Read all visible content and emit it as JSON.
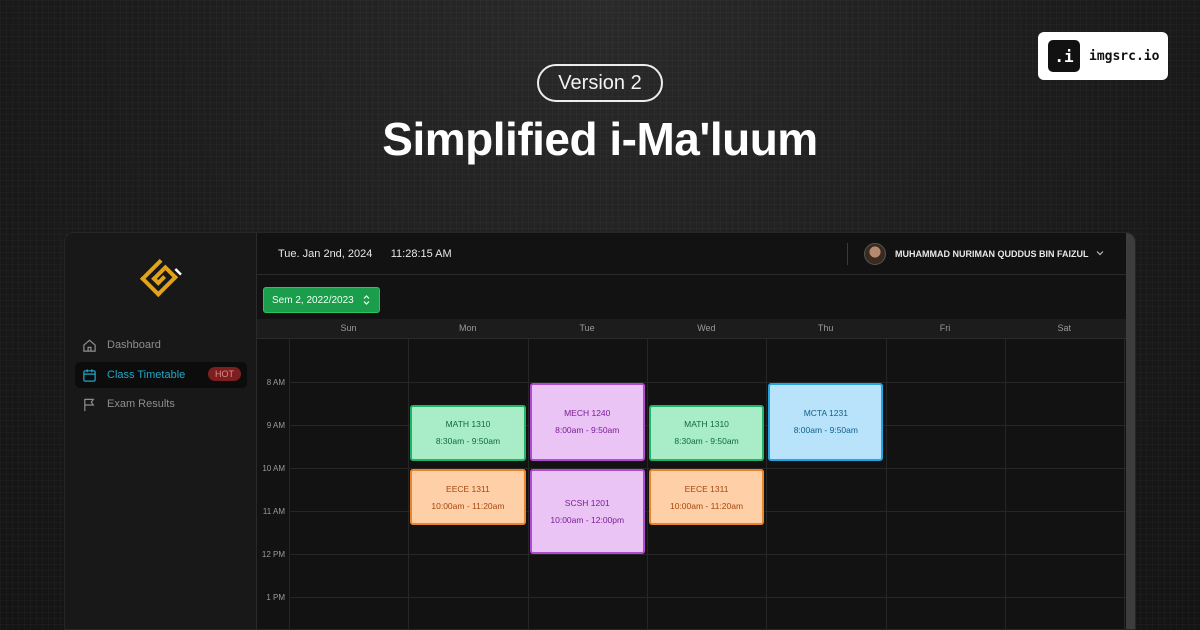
{
  "banner": {
    "version_label": "Version 2",
    "title": "Simplified i-Ma'luum",
    "imgsrc_logo": ".i",
    "imgsrc_label": "imgsrc.io"
  },
  "sidebar": {
    "logo_icon": "kufi-square-logo-icon",
    "items": [
      {
        "label": "Dashboard",
        "icon": "home-icon",
        "active": false
      },
      {
        "label": "Class Timetable",
        "icon": "calendar-icon",
        "active": true,
        "badge": "HOT"
      },
      {
        "label": "Exam Results",
        "icon": "flag-icon",
        "active": false
      }
    ]
  },
  "topbar": {
    "date": "Tue. Jan 2nd, 2024",
    "time": "11:28:15 AM",
    "user_name": "MUHAMMAD NURIMAN QUDDUS BIN FAIZUL"
  },
  "semester_select": {
    "value": "Sem 2, 2022/2023"
  },
  "calendar": {
    "days": [
      "Sun",
      "Mon",
      "Tue",
      "Wed",
      "Thu",
      "Fri",
      "Sat"
    ],
    "hours": [
      "8 AM",
      "9 AM",
      "10 AM",
      "11 AM",
      "12 PM",
      "1 PM"
    ],
    "events": [
      {
        "code": "MATH 1310",
        "time": "8:30am - 9:50am",
        "day": 1,
        "start": 8.5,
        "end": 9.83,
        "color": "green"
      },
      {
        "code": "MECH 1240",
        "time": "8:00am - 9:50am",
        "day": 2,
        "start": 8.0,
        "end": 9.83,
        "color": "purple"
      },
      {
        "code": "MATH 1310",
        "time": "8:30am - 9:50am",
        "day": 3,
        "start": 8.5,
        "end": 9.83,
        "color": "green"
      },
      {
        "code": "MCTA 1231",
        "time": "8:00am - 9:50am",
        "day": 4,
        "start": 8.0,
        "end": 9.83,
        "color": "blue"
      },
      {
        "code": "EECE 1311",
        "time": "10:00am - 11:20am",
        "day": 1,
        "start": 10.0,
        "end": 11.33,
        "color": "orange"
      },
      {
        "code": "SCSH 1201",
        "time": "10:00am - 12:00pm",
        "day": 2,
        "start": 10.0,
        "end": 12.0,
        "color": "purple"
      },
      {
        "code": "EECE 1311",
        "time": "10:00am - 11:20am",
        "day": 3,
        "start": 10.0,
        "end": 11.33,
        "color": "orange"
      }
    ]
  },
  "colors": {
    "green": "#a8ecc8",
    "purple": "#eac4f4",
    "blue": "#b9e3fb",
    "orange": "#ffd0a8",
    "active_nav": "#22a7c7",
    "semester_button": "#1a9e4c"
  }
}
